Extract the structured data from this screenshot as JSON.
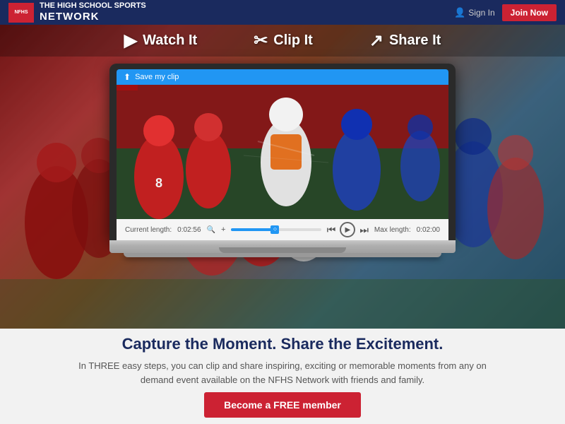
{
  "header": {
    "logo_line1": "THE HIGH SCHOOL SPORTS",
    "logo_line2": "NETWORK",
    "logo_abbr": "NFHS",
    "sign_in_label": "Sign In",
    "join_now_label": "Join Now"
  },
  "hero": {
    "step1_label": "Watch It",
    "step2_label": "Clip It",
    "step3_label": "Share It",
    "save_bar_label": "Save my clip",
    "current_length_label": "Current length:",
    "current_length_value": "0:02:56",
    "max_length_label": "Max length:",
    "max_length_value": "0:02:00"
  },
  "bottom": {
    "tagline": "Capture the Moment. Share the Excitement.",
    "description": "In THREE easy steps, you can clip and share inspiring, exciting or memorable moments from any on demand event available on the NFHS Network with friends and family.",
    "cta_label": "Become a FREE member"
  }
}
